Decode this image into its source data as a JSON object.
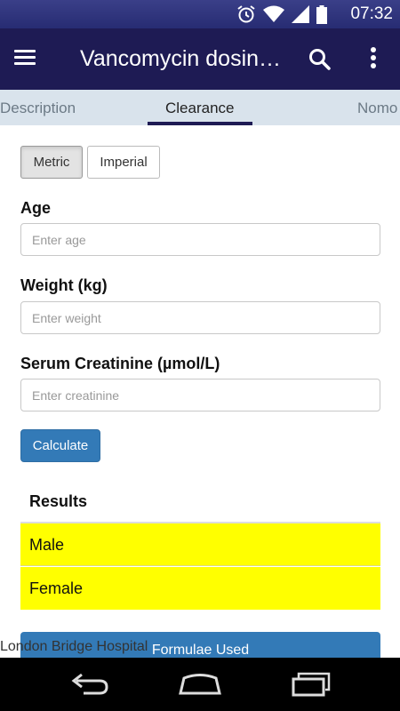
{
  "status_bar": {
    "time": "07:32",
    "icons": [
      "alarm-icon",
      "wifi-icon",
      "signal-icon",
      "battery-icon"
    ]
  },
  "app_bar": {
    "title": "Vancomycin dosin…",
    "icons": [
      "menu-icon",
      "search-icon",
      "more-vert-icon"
    ]
  },
  "tabs": [
    {
      "label": "Description",
      "active": false
    },
    {
      "label": "Clearance",
      "active": true
    },
    {
      "label": "Nomo",
      "active": false
    }
  ],
  "units": {
    "metric": "Metric",
    "imperial": "Imperial",
    "selected": "Metric"
  },
  "form": {
    "age": {
      "label": "Age",
      "placeholder": "Enter age",
      "value": ""
    },
    "weight": {
      "label": "Weight (kg)",
      "placeholder": "Enter weight",
      "value": ""
    },
    "creatinine": {
      "label": "Serum Creatinine (µmol/L)",
      "placeholder": "Enter creatinine",
      "value": ""
    },
    "calculate_label": "Calculate"
  },
  "results": {
    "title": "Results",
    "male_label": "Male",
    "female_label": "Female"
  },
  "formulae_label": "Formulae Used",
  "footer_text": "London Bridge Hospital",
  "colors": {
    "app_bar": "#1e1b54",
    "tab_bar": "#d9e3ec",
    "primary_button": "#337ab7",
    "result_highlight": "#ffff00"
  },
  "nav_bar": {
    "icons": [
      "back-icon",
      "home-icon",
      "recents-icon"
    ]
  }
}
